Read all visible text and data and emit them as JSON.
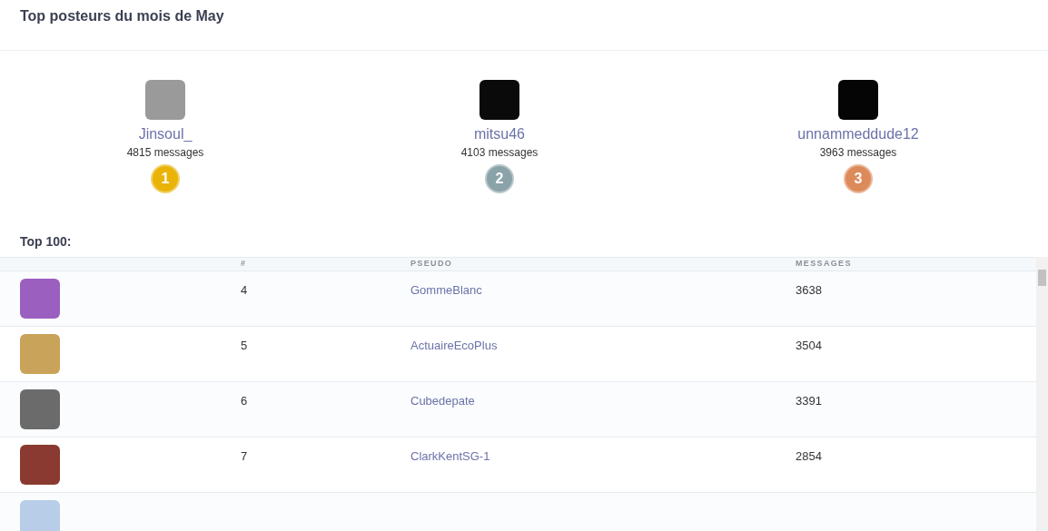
{
  "title": "Top posteurs du mois de May",
  "podium": [
    {
      "name": "Jinsoul_",
      "messages": "4815 messages",
      "medal": "1",
      "color": "#eab308"
    },
    {
      "name": "mitsu46",
      "messages": "4103 messages",
      "medal": "2",
      "color": "#8aa3a8"
    },
    {
      "name": "unnammeddude12",
      "messages": "3963 messages",
      "medal": "3",
      "color": "#dd8a5a"
    }
  ],
  "top_label": "Top 100:",
  "table": {
    "columns": [
      "#",
      "PSEUDO",
      "MESSAGES"
    ],
    "rows": [
      {
        "rank": "4",
        "pseudo": "GommeBlanc",
        "messages": "3638"
      },
      {
        "rank": "5",
        "pseudo": "ActuaireEcoPlus",
        "messages": "3504"
      },
      {
        "rank": "6",
        "pseudo": "Cubedepate",
        "messages": "3391"
      },
      {
        "rank": "7",
        "pseudo": "ClarkKentSG-1",
        "messages": "2854"
      }
    ]
  }
}
